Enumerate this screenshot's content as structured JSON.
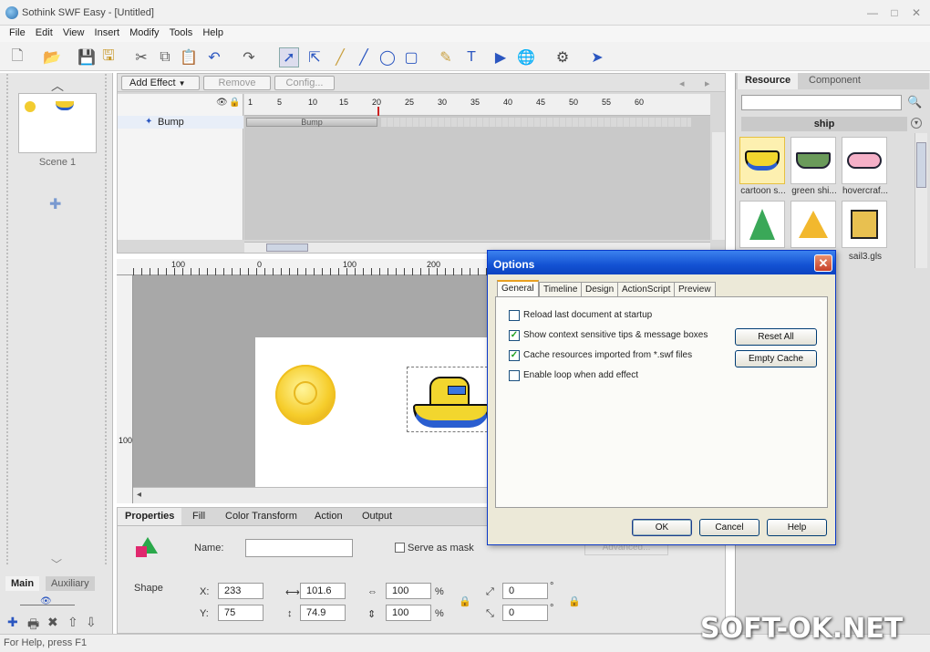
{
  "window": {
    "title": "Sothink SWF Easy - [Untitled]",
    "minimize": "—",
    "maximize": "□",
    "close": "✕"
  },
  "menu": [
    "File",
    "Edit",
    "View",
    "Insert",
    "Modify",
    "Tools",
    "Help"
  ],
  "left": {
    "scene_label": "Scene 1",
    "tab_main": "Main",
    "tab_auxiliary": "Auxiliary"
  },
  "timeline": {
    "add_effect": "Add Effect",
    "remove": "Remove",
    "config": "Config...",
    "layer_name": "Bump",
    "effect_bar": "Bump",
    "ruler_ticks": [
      "1",
      "5",
      "10",
      "15",
      "20",
      "25",
      "30",
      "35",
      "40",
      "45",
      "50",
      "55",
      "60"
    ]
  },
  "stage": {
    "ruler_ticks_h": [
      "100",
      "0",
      "100",
      "200"
    ],
    "ruler_tick_v": "100"
  },
  "properties": {
    "tabs": [
      "Properties",
      "Fill",
      "Color Transform",
      "Action",
      "Output"
    ],
    "shape_label": "Shape",
    "name_label": "Name:",
    "name_value": "",
    "serve_as_mask": "Serve as mask",
    "advanced": "Advanced...",
    "x_label": "X:",
    "x_value": "233",
    "y_label": "Y:",
    "y_value": "75",
    "width_value": "101.6",
    "height_value": "74.9",
    "scale_x": "100",
    "scale_y": "100",
    "percent": "%",
    "skew_x": "0",
    "skew_y": "0",
    "degree": "°"
  },
  "resource": {
    "tab_resource": "Resource",
    "tab_component": "Component",
    "search_value": "",
    "category": "ship",
    "items": [
      "cartoon s...",
      "green shi...",
      "hovercraf...",
      "",
      "",
      "sail3.gls"
    ]
  },
  "status": {
    "text": "For Help, press F1"
  },
  "options_dialog": {
    "title": "Options",
    "tabs": [
      "General",
      "Timeline",
      "Design",
      "ActionScript",
      "Preview"
    ],
    "options": [
      {
        "label": "Reload last document at startup",
        "checked": false
      },
      {
        "label": "Show context sensitive tips & message boxes",
        "checked": true
      },
      {
        "label": "Cache resources imported from *.swf files",
        "checked": true
      },
      {
        "label": "Enable loop when add effect",
        "checked": false
      }
    ],
    "reset_all": "Reset All",
    "empty_cache": "Empty Cache",
    "ok": "OK",
    "cancel": "Cancel",
    "help": "Help"
  },
  "watermark": "SOFT-OK.NET",
  "colors": {
    "dialog_title": "#1352d3",
    "accent": "#0a38c8"
  }
}
